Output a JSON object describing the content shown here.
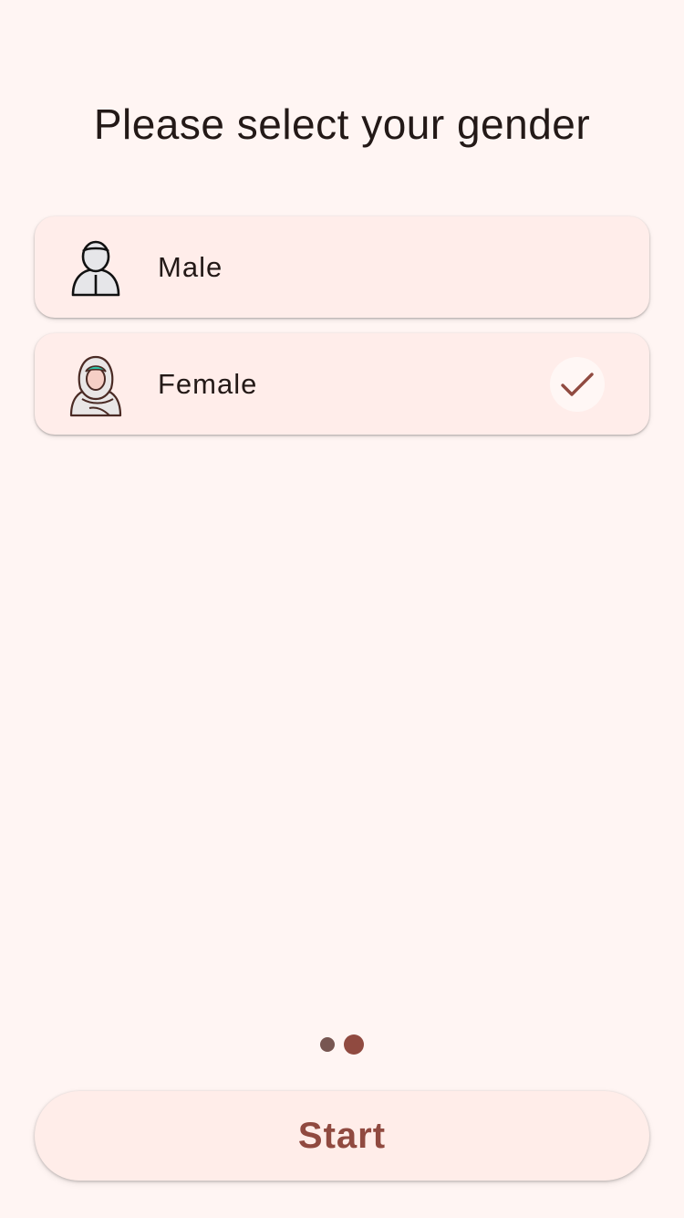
{
  "header": {
    "title": "Please select your gender"
  },
  "options": [
    {
      "label": "Male",
      "icon": "male-avatar-icon",
      "selected": false
    },
    {
      "label": "Female",
      "icon": "female-avatar-icon",
      "selected": true
    }
  ],
  "pager": {
    "total_pages": 2,
    "current_page": 2
  },
  "footer": {
    "start_label": "Start"
  },
  "colors": {
    "background": "#fff5f3",
    "card": "#ffedea",
    "accent": "#904a40",
    "dot_inactive": "#775651",
    "text": "#231917"
  }
}
